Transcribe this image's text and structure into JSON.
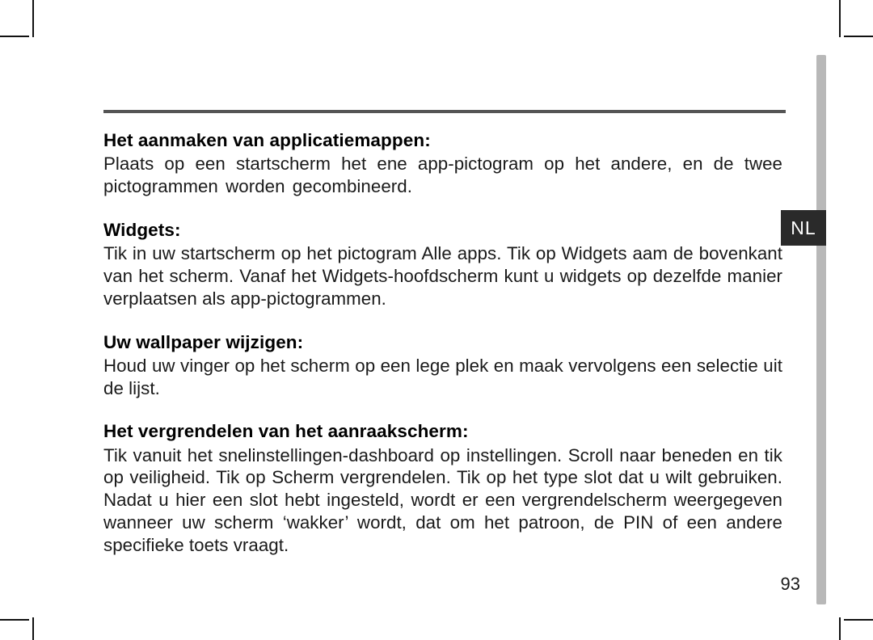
{
  "language_tab": "NL",
  "page_number": "93",
  "sections": {
    "s1": {
      "heading": "Het aanmaken van applicatiemappen:",
      "body": "Plaats op een startscherm het ene app-pictogram op het andere, en de twee pictogrammen worden gecombineerd."
    },
    "s2": {
      "heading": "Widgets:",
      "body": "Tik in uw startscherm op het pictogram Alle apps. Tik op Widgets aam de bovenkant van het scherm. Vanaf het Widgets-hoofdscherm kunt u widgets op dezelfde manier verplaatsen als app-pictogrammen."
    },
    "s3": {
      "heading": "Uw wallpaper wijzigen:",
      "body": "Houd uw vinger op het scherm op een lege plek en maak vervolgens een selectie uit de lijst."
    },
    "s4": {
      "heading": "Het vergrendelen van het aanraakscherm:",
      "body": "Tik vanuit het snelinstellingen-dashboard op instellingen. Scroll naar beneden en tik op veiligheid. Tik op Scherm vergrendelen. Tik op het type slot dat u wilt gebruiken. Nadat u hier een slot hebt ingesteld, wordt er een vergrendelscherm weergegeven wanneer uw scherm ‘wakker’ wordt, dat om het patroon, de PIN of een andere specifieke toets vraagt."
    }
  }
}
